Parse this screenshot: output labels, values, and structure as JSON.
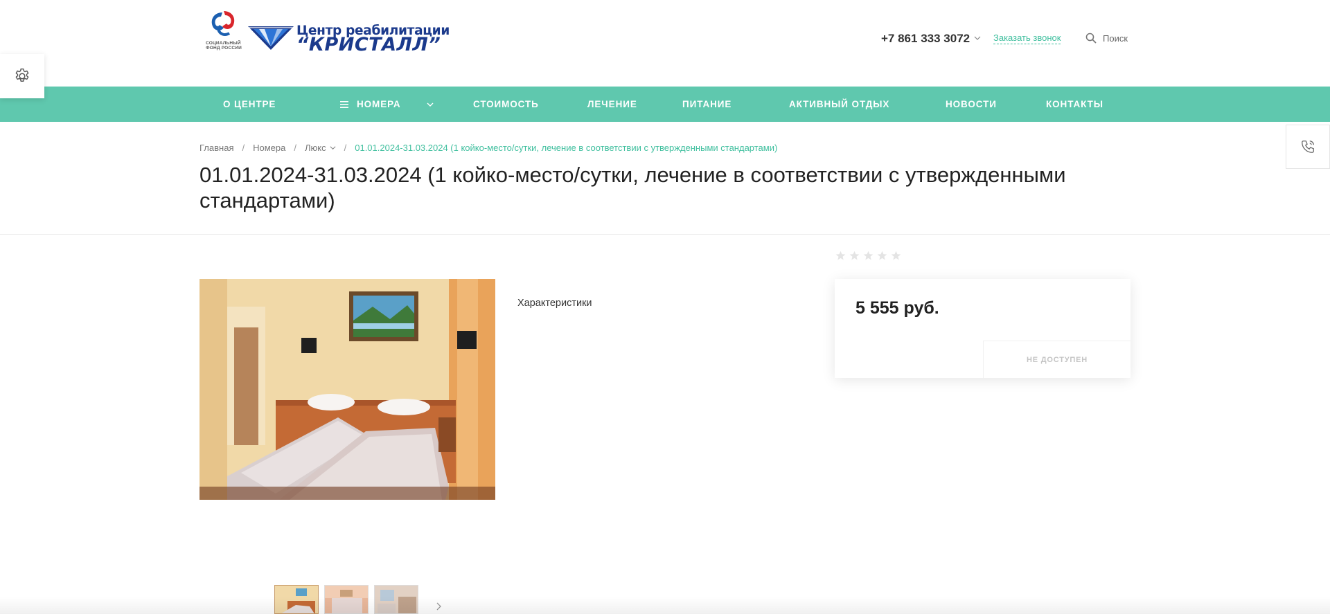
{
  "header": {
    "sfr_logo_text": "СОЦИАЛЬНЫЙ ФОНД РОССИИ",
    "logo_line1": "Центр реабилитации",
    "logo_line2": "“КРИСТАЛЛ”",
    "phone": "+7 861 333 3072",
    "callback_label": "Заказать звонок",
    "search_label": "Поиск"
  },
  "nav": {
    "items": [
      {
        "label": "О ЦЕНТРЕ"
      },
      {
        "label": "НОМЕРА"
      },
      {
        "label": "СТОИМОСТЬ"
      },
      {
        "label": "ЛЕЧЕНИЕ"
      },
      {
        "label": "ПИТАНИЕ"
      },
      {
        "label": "АКТИВНЫЙ ОТДЫХ"
      },
      {
        "label": "НОВОСТИ"
      },
      {
        "label": "КОНТАКТЫ"
      }
    ]
  },
  "breadcrumb": {
    "home": "Главная",
    "rooms": "Номера",
    "category": "Люкс",
    "current": "01.01.2024-31.03.2024 (1 койко-место/сутки, лечение в соответствии с утвержденными стандартами)",
    "separator": "/"
  },
  "product": {
    "title": "01.01.2024-31.03.2024 (1 койко-место/сутки, лечение в соответствии с утвержденными стандартами)",
    "characteristics_label": "Характеристики",
    "rating": 0,
    "rating_max": 5,
    "price": "5 555 руб.",
    "availability": "НЕ ДОСТУПЕН"
  },
  "colors": {
    "accent": "#5fc8ae",
    "link": "#3fbf9e",
    "brand_blue": "#1b3a8c",
    "sfr_red": "#d9262c"
  },
  "icons": [
    "settings-gear-icon",
    "phone-callback-icon",
    "search-icon",
    "burger-menu-icon",
    "chevron-down-icon",
    "star-icon",
    "chevron-right-icon"
  ]
}
